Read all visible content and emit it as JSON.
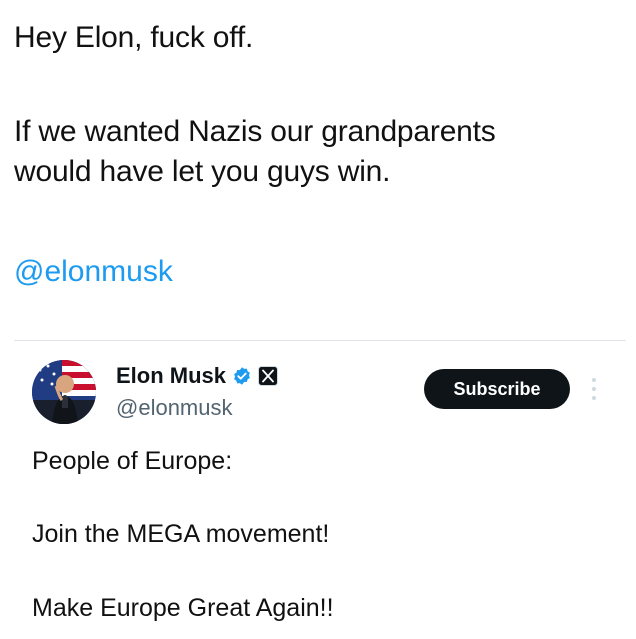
{
  "post": {
    "line1": "Hey Elon, fuck off.",
    "line2": "If we wanted Nazis our grandparents",
    "line3": "would have let you guys win.",
    "mention": "@elonmusk"
  },
  "quoted_post": {
    "author_name": "Elon Musk",
    "handle": "@elonmusk",
    "subscribe_label": "Subscribe",
    "lines": [
      "People of Europe:",
      "Join the MEGA movement!",
      "Make Europe Great Again!!"
    ]
  },
  "icons": {
    "verified": "verified-badge-icon",
    "affiliate": "x-logo-icon",
    "more": "more-vertical-icon"
  },
  "colors": {
    "mention": "#1d9bf0",
    "verified": "#1d9bf0",
    "button_bg": "#0f1419",
    "handle": "#536471"
  }
}
